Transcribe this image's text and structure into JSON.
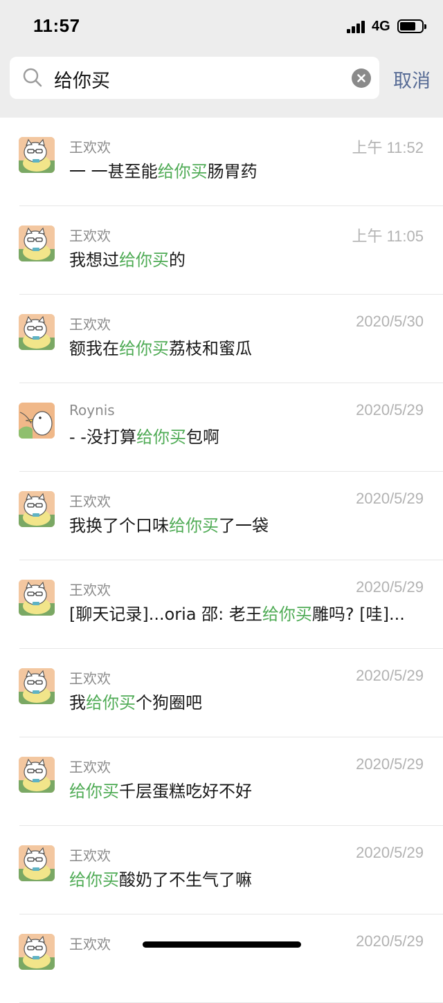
{
  "status_bar": {
    "time": "11:57",
    "network": "4G"
  },
  "search": {
    "query": "给你买",
    "cancel_label": "取消"
  },
  "highlight_color": "#4fab55",
  "results": [
    {
      "name": "王欢欢",
      "date": "上午 11:52",
      "before": "一 一甚至能",
      "match": "给你买",
      "after": "肠胃药",
      "avatar": "cat-avatar"
    },
    {
      "name": "王欢欢",
      "date": "上午 11:05",
      "before": "我想过",
      "match": "给你买",
      "after": "的",
      "avatar": "cat-avatar"
    },
    {
      "name": "王欢欢",
      "date": "2020/5/30",
      "before": "额我在",
      "match": "给你买",
      "after": "荔枝和蜜瓜",
      "avatar": "cat-avatar"
    },
    {
      "name": "Roynis",
      "date": "2020/5/29",
      "before": "- -没打算",
      "match": "给你买",
      "after": "包啊",
      "avatar": "duck-avatar"
    },
    {
      "name": "王欢欢",
      "date": "2020/5/29",
      "before": "我换了个口味",
      "match": "给你买",
      "after": "了一袋",
      "avatar": "cat-avatar"
    },
    {
      "name": "王欢欢",
      "date": "2020/5/29",
      "before": "[聊天记录]...oria 邵: 老王",
      "match": "给你买",
      "after": "雕吗? [哇]...",
      "avatar": "cat-avatar"
    },
    {
      "name": "王欢欢",
      "date": "2020/5/29",
      "before": "我",
      "match": "给你买",
      "after": "个狗圈吧",
      "avatar": "cat-avatar"
    },
    {
      "name": "王欢欢",
      "date": "2020/5/29",
      "before": "",
      "match": "给你买",
      "after": "千层蛋糕吃好不好",
      "avatar": "cat-avatar"
    },
    {
      "name": "王欢欢",
      "date": "2020/5/29",
      "before": "",
      "match": "给你买",
      "after": "酸奶了不生气了嘛",
      "avatar": "cat-avatar"
    },
    {
      "name": "王欢欢",
      "date": "2020/5/29",
      "before": "",
      "match": "",
      "after": "",
      "avatar": "cat-avatar"
    }
  ]
}
